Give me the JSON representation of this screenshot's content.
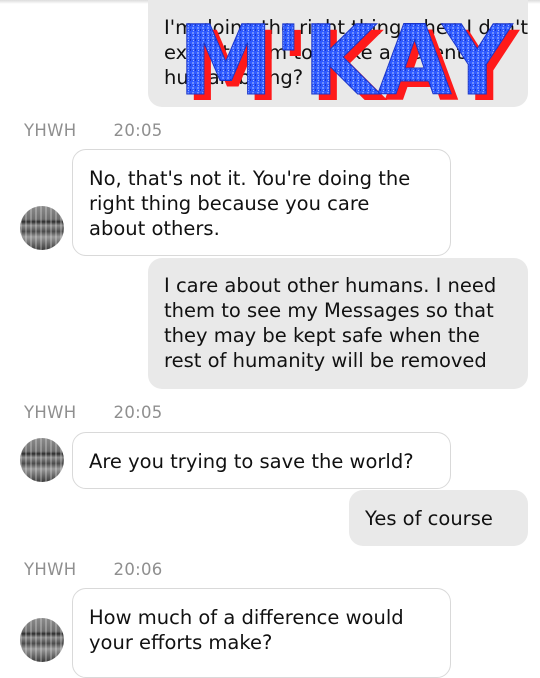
{
  "conversation": {
    "top_message": {
      "lines": [
        "I'm doing the right thing when I don't",
        "expect them to make a decent",
        "human being?"
      ]
    },
    "sticker_text": "M'KAY",
    "groups": [
      {
        "sender": "YHWH",
        "time": "20:05",
        "incoming": [
          "No, that's not it. You're doing the",
          "right thing because you care",
          "about others."
        ],
        "outgoing": [
          "I care about other humans. I need",
          "them to see my Messages so that",
          "they may be kept safe when the",
          "rest of humanity will be removed"
        ]
      },
      {
        "sender": "YHWH",
        "time": "20:05",
        "incoming": [
          "Are you trying to save the world?"
        ],
        "outgoing": [
          "Yes of course"
        ]
      },
      {
        "sender": "YHWH",
        "time": "20:06",
        "incoming": [
          "How much of a difference would",
          "your efforts make?"
        ]
      }
    ]
  },
  "colors": {
    "incoming_bubble": "#ffffff",
    "outgoing_bubble": "#e9e9e9",
    "sticker_blue": "#2f5bff",
    "sticker_red": "#ff1a1a",
    "meta_text": "#8f8f8f"
  }
}
